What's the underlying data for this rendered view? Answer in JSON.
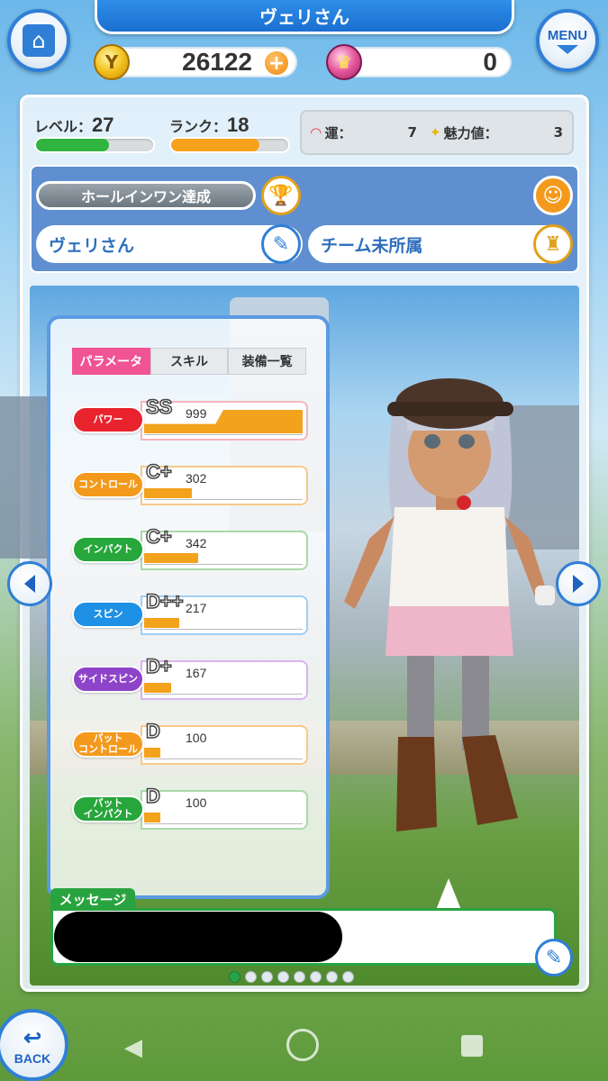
{
  "header": {
    "player_name": "ヴェリさん",
    "menu_label": "MENU",
    "gold": "26122",
    "gems": "0"
  },
  "stats_top": {
    "level_label": "レベル：",
    "level": "27",
    "level_progress": 0.62,
    "rank_label": "ランク：",
    "rank": "18",
    "rank_progress": 0.75,
    "luck_label": "運：",
    "luck": "7",
    "charm_label": "魅力値：",
    "charm": "3"
  },
  "profile": {
    "achievement": "ホールインワン達成",
    "name": "ヴェリさん",
    "team": "チーム未所属"
  },
  "tabs": [
    "パラメータ",
    "スキル",
    "装備一覧"
  ],
  "parameters": [
    {
      "name": "パワー",
      "grade": "SS",
      "value": "999",
      "fill": 1.0,
      "color": "#e8232d",
      "border": "#f3b6c0"
    },
    {
      "name": "コントロール",
      "grade": "C+",
      "value": "302",
      "fill": 0.3,
      "color": "#f39a1c",
      "border": "#f7c98a"
    },
    {
      "name": "インパクト",
      "grade": "C+",
      "value": "342",
      "fill": 0.34,
      "color": "#27a63b",
      "border": "#a9d9a6"
    },
    {
      "name": "スピン",
      "grade": "D++",
      "value": "217",
      "fill": 0.22,
      "color": "#1e90e6",
      "border": "#9fcff2"
    },
    {
      "name": "サイドスピン",
      "grade": "D+",
      "value": "167",
      "fill": 0.17,
      "color": "#8e44c9",
      "border": "#d9b4ee"
    },
    {
      "name": "パット\nコントロール",
      "grade": "D",
      "value": "100",
      "fill": 0.1,
      "color": "#f39a1c",
      "border": "#f7c98a"
    },
    {
      "name": "パット\nインパクト",
      "grade": "D",
      "value": "100",
      "fill": 0.1,
      "color": "#27a63b",
      "border": "#a9d9a6"
    }
  ],
  "message": {
    "label": "メッセージ"
  },
  "pagination": {
    "count": 8,
    "active": 0
  },
  "footer": {
    "back_label": "BACK"
  },
  "colors": {
    "accent": "#2f7fd6",
    "bar_fill": "#f3a21c",
    "level_bar": "#2fb53f",
    "rank_bar": "#f7a21c"
  }
}
